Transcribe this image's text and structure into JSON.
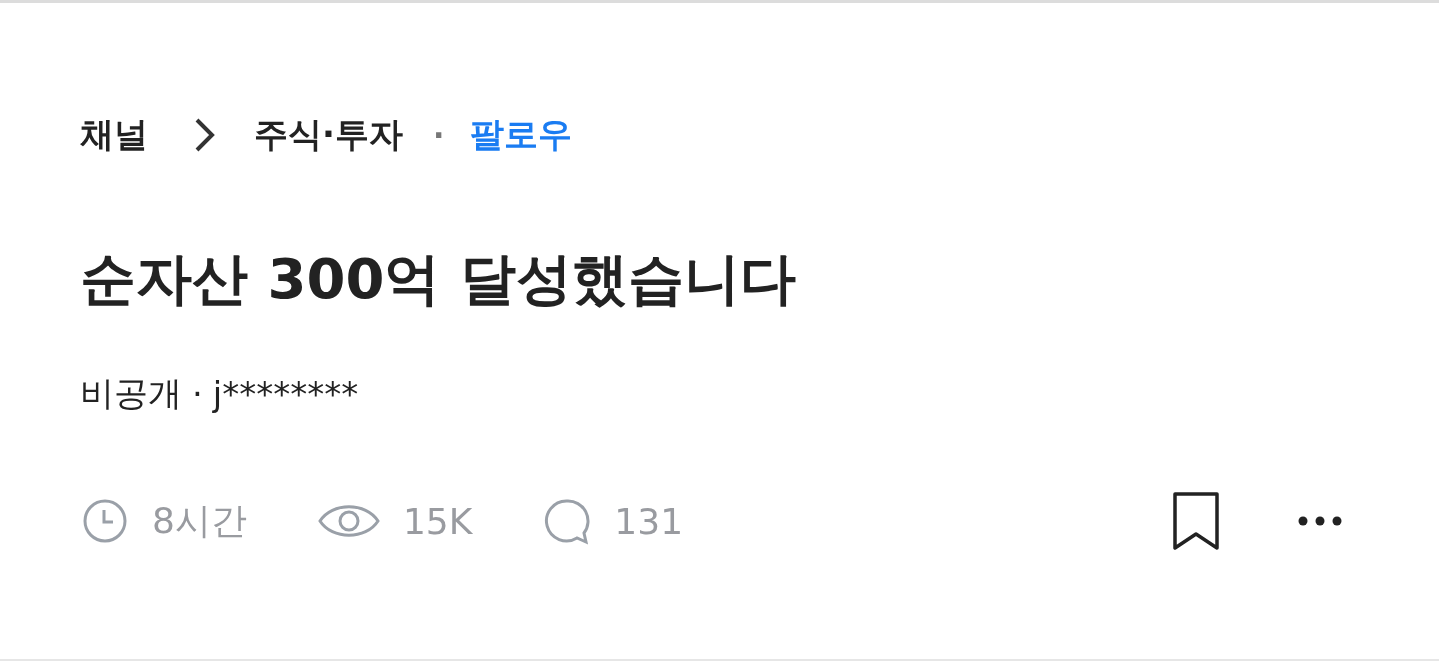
{
  "breadcrumb": {
    "root": "채널",
    "category": "주식·투자",
    "dot": "·",
    "follow": "팔로우"
  },
  "title": "순자산 300억 달성했습니다",
  "author": {
    "visibility": "비공개",
    "dot": "·",
    "name": "j********"
  },
  "stats": [
    {
      "kind": "time",
      "text": "8시간"
    },
    {
      "kind": "views",
      "text": "15K"
    },
    {
      "kind": "comments",
      "text": "131"
    }
  ]
}
